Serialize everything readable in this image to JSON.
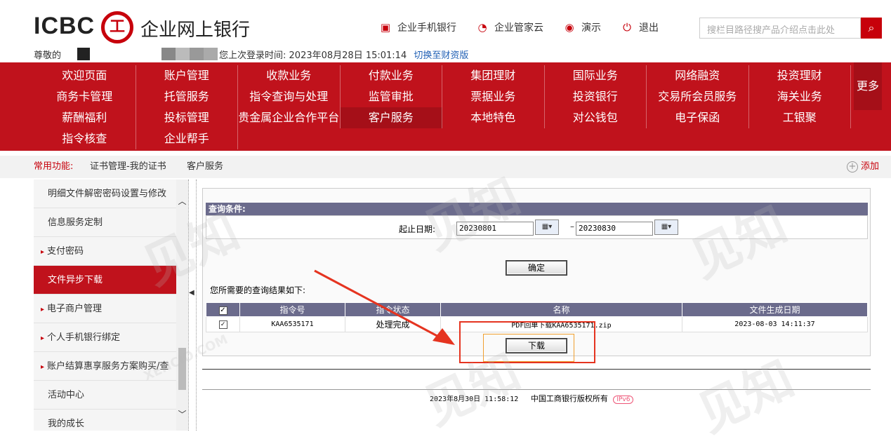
{
  "header": {
    "logo_text": "ICBC",
    "logo_mark": "工",
    "bank_name": "企业网上银行",
    "links": [
      {
        "label": "企业手机银行",
        "icon": "mobile-bank-icon"
      },
      {
        "label": "企业管家云",
        "icon": "cloud-icon"
      },
      {
        "label": "演示",
        "icon": "eye-icon"
      },
      {
        "label": "退出",
        "icon": "power-icon"
      }
    ],
    "search_placeholder": "搜栏目路径搜产品介绍点击此处",
    "greeting": "尊敬的",
    "last_login_label": "您上次登录时间:",
    "last_login_time": "2023年08月28日 15:01:14",
    "switch_link": "切换至财资版"
  },
  "nav": {
    "items": [
      "欢迎页面",
      "账户管理",
      "收款业务",
      "付款业务",
      "集团理财",
      "国际业务",
      "网络融资",
      "投资理财",
      "商务卡管理",
      "托管服务",
      "指令查询与处理",
      "监管审批",
      "票据业务",
      "投资银行",
      "交易所会员服务",
      "海关业务",
      "薪酬福利",
      "投标管理",
      "贵金属企业合作平台",
      "客户服务",
      "本地特色",
      "对公钱包",
      "电子保函",
      "工银聚",
      "指令核查",
      "企业帮手"
    ],
    "active_index": 19,
    "more": "更多"
  },
  "common": {
    "label": "常用功能:",
    "items": [
      "证书管理-我的证书",
      "客户服务"
    ],
    "add": "添加"
  },
  "sidebar": {
    "items": [
      {
        "label": "明细文件解密密码设置与修改",
        "arrow": false
      },
      {
        "label": "信息服务定制",
        "arrow": false
      },
      {
        "label": "支付密码",
        "arrow": true
      },
      {
        "label": "文件异步下载",
        "arrow": false,
        "active": true
      },
      {
        "label": "电子商户管理",
        "arrow": true
      },
      {
        "label": "个人手机银行绑定",
        "arrow": true
      },
      {
        "label": "账户结算惠享服务方案购买/查",
        "arrow": true
      },
      {
        "label": "活动中心",
        "arrow": false
      },
      {
        "label": "我的成长",
        "arrow": false
      }
    ]
  },
  "query": {
    "header": "查询条件:",
    "date_label": "起止日期:",
    "start_date": "20230801",
    "end_date": "20230830",
    "dash": "–",
    "confirm": "确定",
    "result_label": "您所需要的查询结果如下:"
  },
  "table": {
    "columns": [
      "",
      "指令号",
      "指令状态",
      "名称",
      "文件生成日期"
    ],
    "rows": [
      {
        "checked": true,
        "id": "KAA6535171",
        "status": "处理完成",
        "name": "PDF回单下载KAA6535171.zip",
        "date": "2023-08-03 14:11:37"
      }
    ],
    "download": "下载"
  },
  "footer": {
    "time": "2023年8月30日 11:58:12",
    "copyright": "中国工商银行版权所有",
    "ipv6": "IPv6"
  },
  "watermark": {
    "text": "见知",
    "sub": "XENCIO.COM"
  },
  "colors": {
    "brand_red": "#c0121c",
    "table_header": "#6b6b8c",
    "annotation": "#e53420"
  }
}
